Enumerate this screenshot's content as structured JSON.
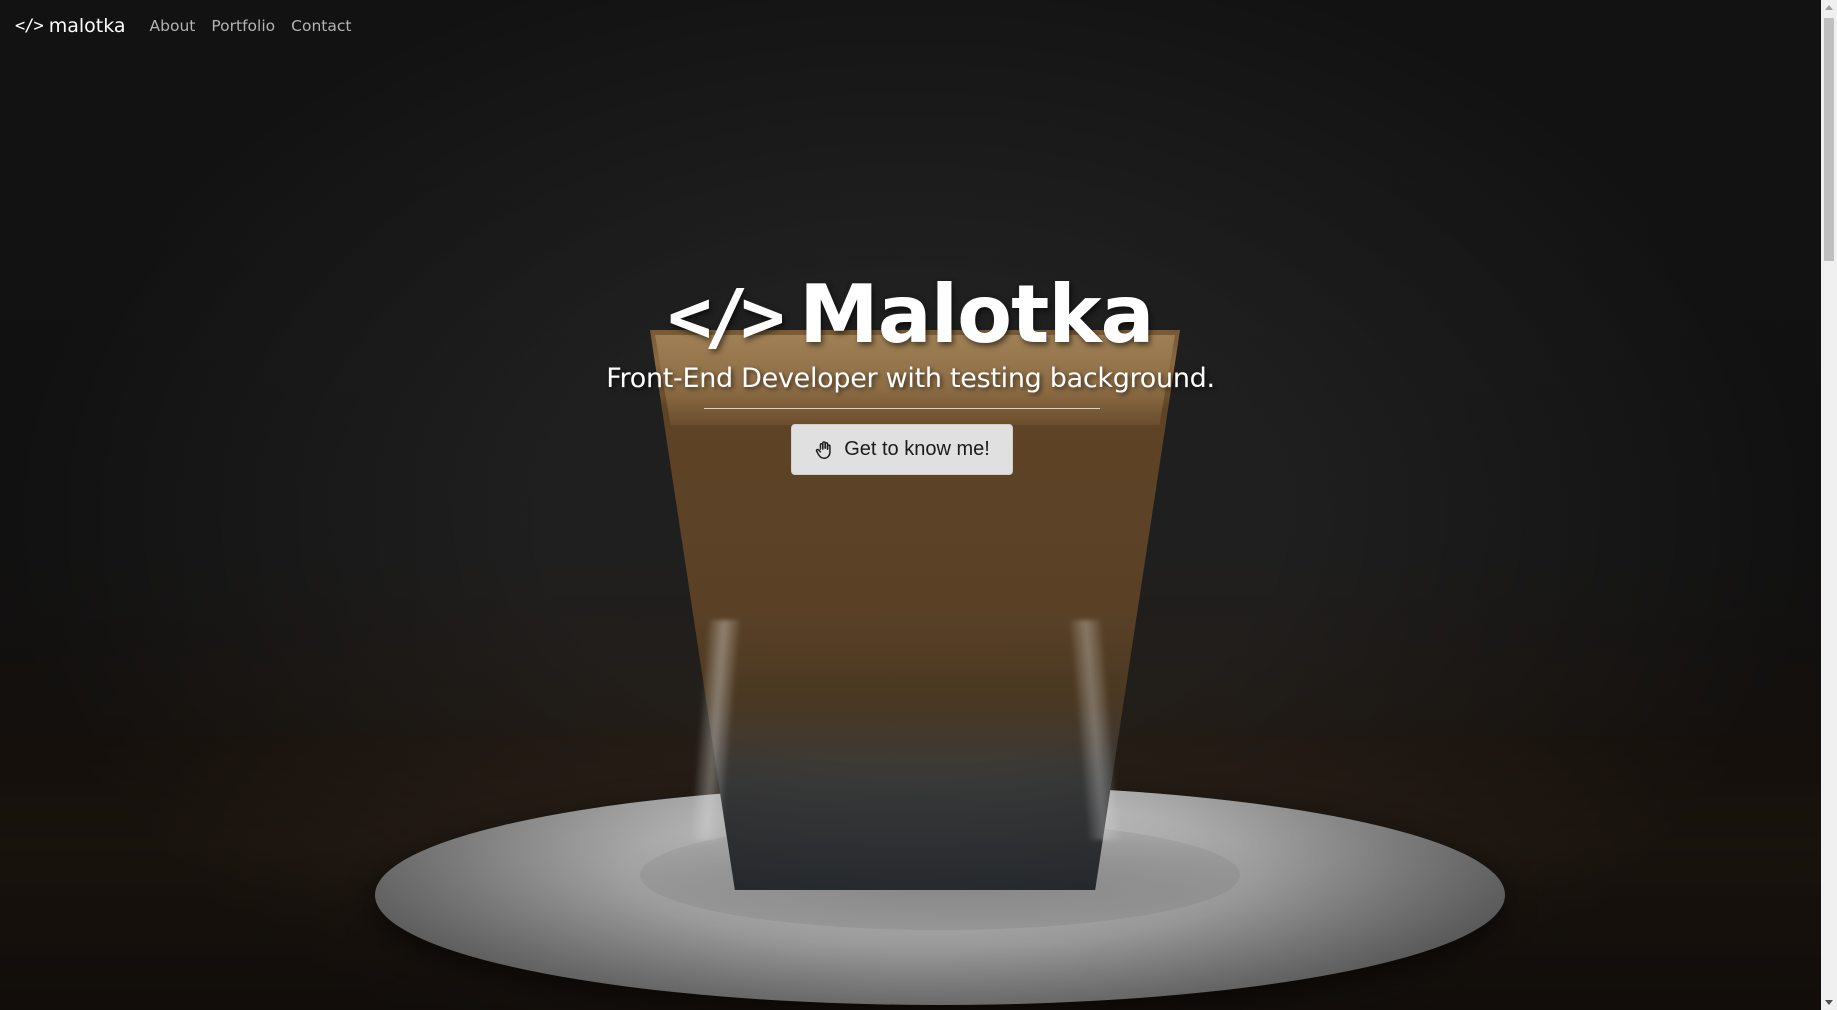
{
  "navbar": {
    "brand_icon": "</>",
    "brand_name": "malotka",
    "links": [
      {
        "label": "About"
      },
      {
        "label": "Portfolio"
      },
      {
        "label": "Contact"
      }
    ]
  },
  "hero": {
    "title_icon": "</>",
    "title": "Malotka",
    "subtitle": "Front-End Developer with testing background.",
    "cta_label": "Get to know me!",
    "cta_icon": "hand-wave-icon"
  },
  "colors": {
    "background": "#1e1e1e",
    "nav_link": "#b3b3b3",
    "button_bg": "#e0e0e0",
    "text": "#ffffff"
  }
}
